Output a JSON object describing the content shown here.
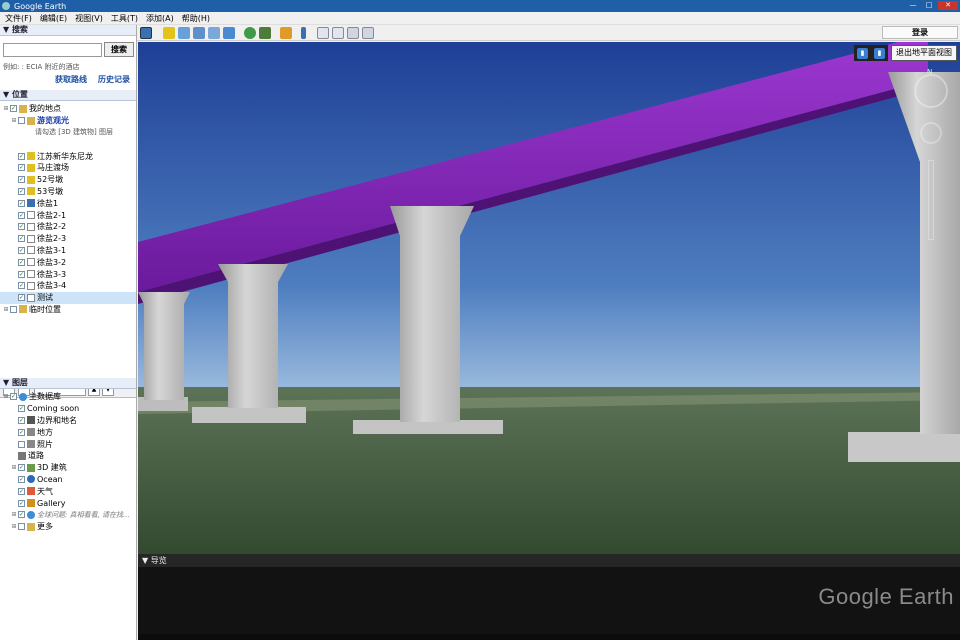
{
  "window": {
    "title": "Google Earth"
  },
  "menu": [
    "文件(F)",
    "编辑(E)",
    "视图(V)",
    "工具(T)",
    "添加(A)",
    "帮助(H)"
  ],
  "toolbar": {
    "login_label": "登录"
  },
  "search": {
    "header": "▼ 搜索",
    "input_value": "",
    "button_label": "搜索",
    "hint": "例如: : ECIA 附近的酒店",
    "directions_link": "获取路线",
    "history_link": "历史记录"
  },
  "places": {
    "header": "▼ 位置",
    "items": [
      {
        "label": "我的地点",
        "indent": 0,
        "checked": true,
        "kind": "folder"
      },
      {
        "label": "游览观光",
        "indent": 1,
        "checked": false,
        "kind": "folder",
        "highlight": true
      },
      {
        "label": "请勾选 [3D 建筑物] 图层",
        "indent": 2,
        "checked": null,
        "kind": "note"
      },
      {
        "label": "",
        "indent": 0,
        "checked": null,
        "kind": "blank"
      },
      {
        "label": "江苏新华东尼龙",
        "indent": 1,
        "checked": true,
        "kind": "pin"
      },
      {
        "label": "马庄渡场",
        "indent": 1,
        "checked": true,
        "kind": "pin"
      },
      {
        "label": "52号墩",
        "indent": 1,
        "checked": true,
        "kind": "pin"
      },
      {
        "label": "53号墩",
        "indent": 1,
        "checked": true,
        "kind": "pin"
      },
      {
        "label": "徐盐1",
        "indent": 1,
        "checked": true,
        "kind": "path"
      },
      {
        "label": "徐盐2-1",
        "indent": 1,
        "checked": true,
        "kind": "poly"
      },
      {
        "label": "徐盐2-2",
        "indent": 1,
        "checked": true,
        "kind": "poly"
      },
      {
        "label": "徐盐2-3",
        "indent": 1,
        "checked": true,
        "kind": "poly"
      },
      {
        "label": "徐盐3-1",
        "indent": 1,
        "checked": true,
        "kind": "poly"
      },
      {
        "label": "徐盐3-2",
        "indent": 1,
        "checked": true,
        "kind": "poly"
      },
      {
        "label": "徐盐3-3",
        "indent": 1,
        "checked": true,
        "kind": "poly"
      },
      {
        "label": "徐盐3-4",
        "indent": 1,
        "checked": true,
        "kind": "poly"
      },
      {
        "label": "测试",
        "indent": 1,
        "checked": true,
        "kind": "poly",
        "selected": true
      },
      {
        "label": "临时位置",
        "indent": 0,
        "checked": false,
        "kind": "folder"
      }
    ]
  },
  "layers": {
    "header": "▼ 图层",
    "items": [
      {
        "label": "主数据库",
        "indent": 0,
        "checked": true,
        "kind": "globe"
      },
      {
        "label": "Coming soon",
        "indent": 1,
        "checked": true,
        "kind": "none"
      },
      {
        "label": "边界和地名",
        "indent": 1,
        "checked": true,
        "kind": "flag"
      },
      {
        "label": "地方",
        "indent": 1,
        "checked": true,
        "kind": "box"
      },
      {
        "label": "照片",
        "indent": 1,
        "checked": false,
        "kind": "box"
      },
      {
        "label": "道路",
        "indent": 1,
        "checked": null,
        "kind": "road"
      },
      {
        "label": "3D 建筑",
        "indent": 1,
        "checked": true,
        "kind": "building"
      },
      {
        "label": "Ocean",
        "indent": 1,
        "checked": true,
        "kind": "ocean"
      },
      {
        "label": "天气",
        "indent": 1,
        "checked": true,
        "kind": "weather"
      },
      {
        "label": "Gallery",
        "indent": 1,
        "checked": true,
        "kind": "gallery"
      },
      {
        "label": "全球问题: 真相看看, 请在找...",
        "indent": 1,
        "checked": true,
        "kind": "globe",
        "italic": true
      },
      {
        "label": "更多",
        "indent": 1,
        "checked": false,
        "kind": "folder"
      }
    ]
  },
  "view": {
    "exit_label": "退出地平面视图",
    "compass_letter": "N"
  },
  "tour": {
    "header": "▼ 导览",
    "logo": "Google Earth"
  },
  "colors": {
    "bridge": "#7a1fb0",
    "sky_top": "#1e3f96",
    "sky_bottom": "#8fb3d8",
    "ground": "#3d5a3a",
    "pier": "#c9c9c9"
  }
}
